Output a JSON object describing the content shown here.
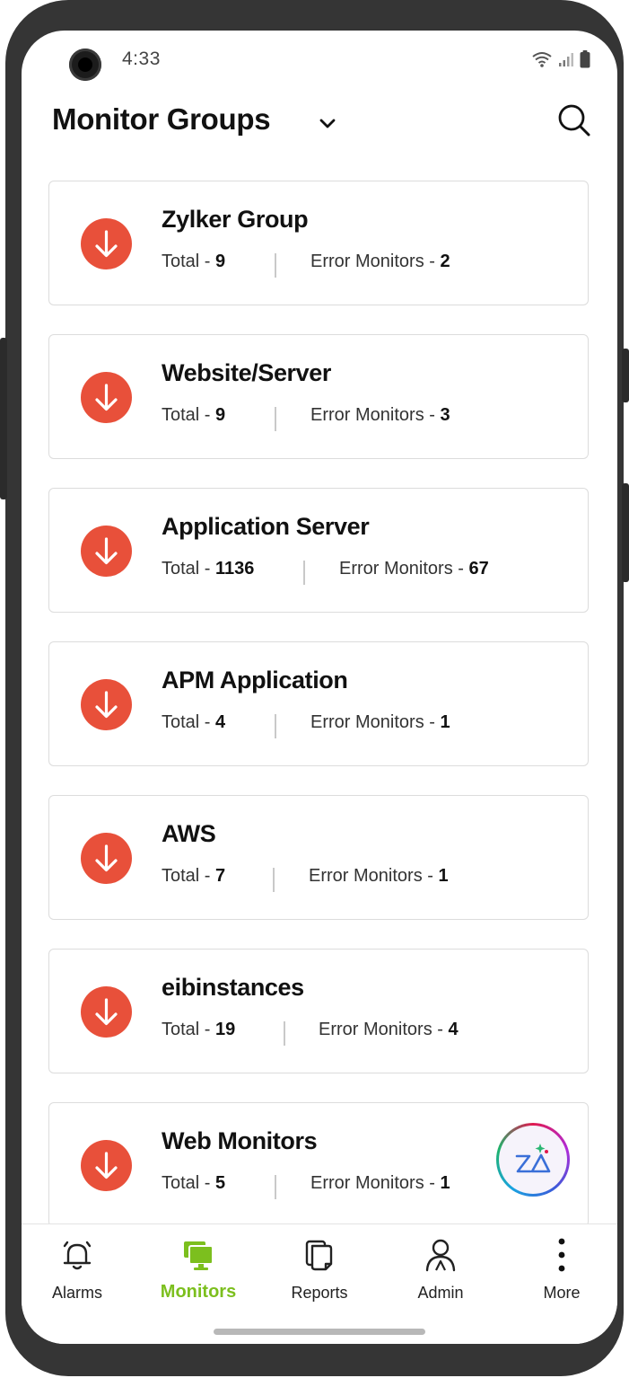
{
  "status_bar": {
    "time": "4:33"
  },
  "header": {
    "title": "Monitor Groups"
  },
  "labels": {
    "total": "Total - ",
    "error": "Error Monitors - "
  },
  "groups": [
    {
      "name": "Zylker Group",
      "total": "9",
      "error_monitors": "2"
    },
    {
      "name": "Website/Server",
      "total": "9",
      "error_monitors": "3"
    },
    {
      "name": "Application Server",
      "total": "1136",
      "error_monitors": "67"
    },
    {
      "name": "APM Application",
      "total": "4",
      "error_monitors": "1"
    },
    {
      "name": "AWS",
      "total": "7",
      "error_monitors": "1"
    },
    {
      "name": "eibinstances",
      "total": "19",
      "error_monitors": "4"
    },
    {
      "name": "Web Monitors",
      "total": "5",
      "error_monitors": "1"
    }
  ],
  "bottom_nav": [
    {
      "label": "Alarms",
      "icon": "bell-icon"
    },
    {
      "label": "Monitors",
      "icon": "monitors-icon",
      "active": true
    },
    {
      "label": "Reports",
      "icon": "reports-icon"
    },
    {
      "label": "Admin",
      "icon": "user-icon"
    },
    {
      "label": "More",
      "icon": "more-vertical-icon"
    }
  ],
  "colors": {
    "status_down": "#e8503a",
    "accent": "#7cbf1e"
  }
}
